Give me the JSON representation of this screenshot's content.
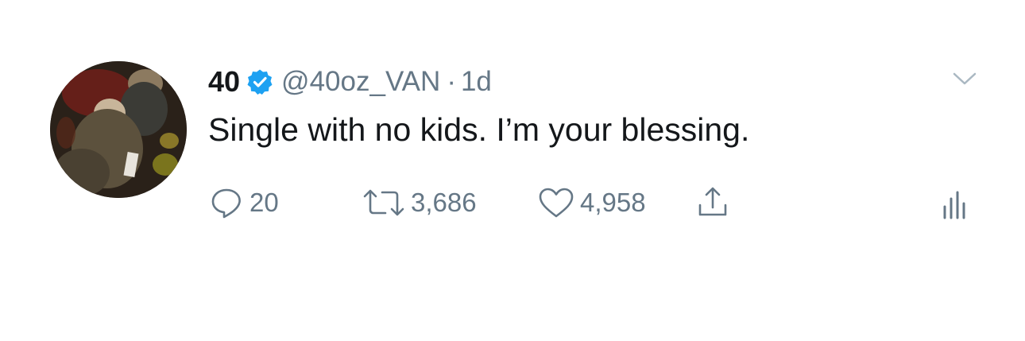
{
  "tweet": {
    "display_name": "40",
    "handle": "@40oz_VAN",
    "separator": "·",
    "timestamp": "1d",
    "text": "Single with no kids. I’m your blessing.",
    "verified": true
  },
  "actions": {
    "reply_count": "20",
    "retweet_count": "3,686",
    "like_count": "4,958"
  },
  "icons": {
    "reply": "reply-icon",
    "retweet": "retweet-icon",
    "like": "heart-icon",
    "share": "share-icon",
    "analytics": "analytics-icon",
    "menu": "chevron-down-icon",
    "verified": "verified-badge-icon"
  },
  "colors": {
    "text_primary": "#14171a",
    "text_secondary": "#657786",
    "verified_blue": "#1da1f2",
    "background": "#ffffff"
  }
}
